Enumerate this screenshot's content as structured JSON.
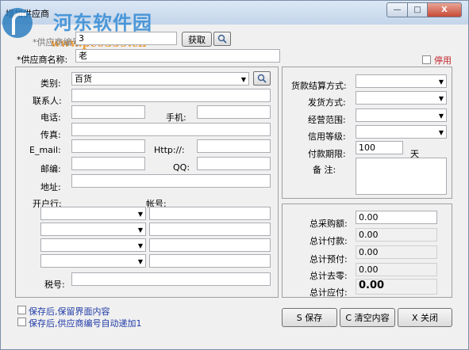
{
  "window": {
    "title": "增加供应商",
    "min_symbol": "—",
    "max_symbol": "□",
    "close_symbol": "X"
  },
  "watermark": {
    "name": "河东软件园",
    "url": "www.pc0359.cn"
  },
  "header": {
    "supplier_no_label": "*供应商编号:",
    "supplier_no_value": "3",
    "fetch_button": "获取",
    "supplier_name_label": "*供应商名称:",
    "supplier_name_value": "老",
    "disable_label": "停用"
  },
  "left": {
    "category_label": "类别:",
    "category_value": "百货",
    "contact_label": "联系人:",
    "phone_label": "电话:",
    "mobile_label": "手机:",
    "fax_label": "传真:",
    "email_label": "E_mail:",
    "http_label": "Http://:",
    "zip_label": "邮编:",
    "qq_label": "QQ:",
    "address_label": "地址:",
    "bank_label": "开户行:",
    "account_label": "帐号:",
    "tax_label": "税号:"
  },
  "right_top": {
    "payment_method_label": "货款结算方式:",
    "shipping_method_label": "发货方式:",
    "business_scope_label": "经营范围:",
    "credit_level_label": "信用等级:",
    "payment_term_label": "付款期限:",
    "payment_term_value": "100",
    "payment_term_unit": "天",
    "remark_label": "备  注:"
  },
  "right_bottom": {
    "total_purchase_label": "总采购额:",
    "total_purchase_value": "0.00",
    "total_paid_label": "总计付款:",
    "total_paid_value": "0.00",
    "total_prepaid_label": "总计预付:",
    "total_prepaid_value": "0.00",
    "total_writeoff_label": "总计去零:",
    "total_writeoff_value": "0.00",
    "total_payable_label": "总计应付:",
    "total_payable_value": "0.00"
  },
  "footer": {
    "keep_content_label": "保存后,保留界面内容",
    "auto_increment_label": "保存后,供应商编号自动递加1",
    "save_button": "S 保存",
    "clear_button": "C 清空内容",
    "close_button": "X 关闭"
  },
  "colors": {
    "title_gradient_top": "#dbe7f5",
    "footer_label_blue": "#1f3aa6",
    "disable_red": "#c0232b",
    "close_red": "#c74a36"
  },
  "icons": [
    "search-icon",
    "dropdown-arrow-icon",
    "minimize-icon",
    "maximize-icon",
    "close-icon"
  ]
}
